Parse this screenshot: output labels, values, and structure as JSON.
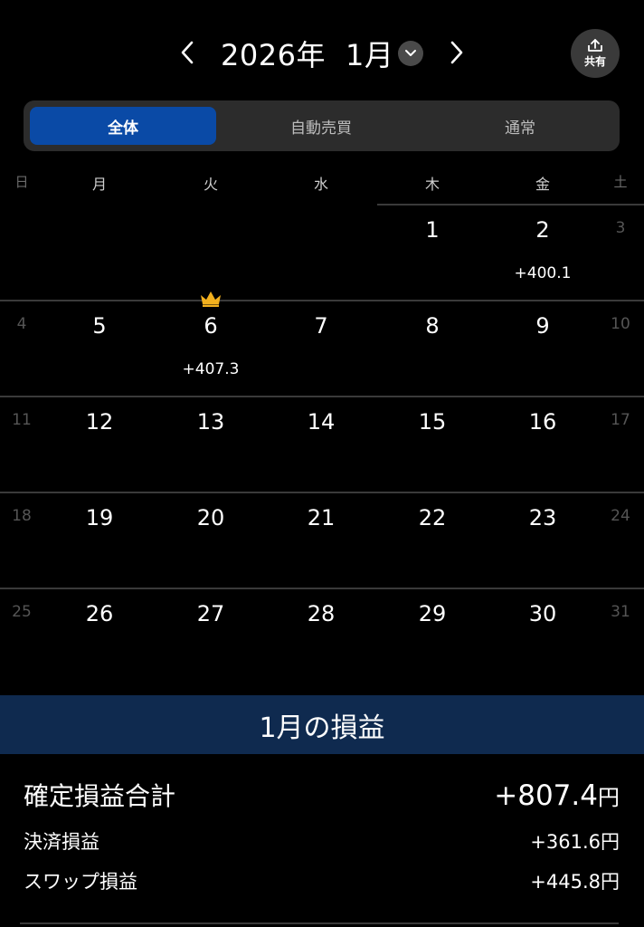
{
  "header": {
    "year_label": "2026年",
    "month_label": "1月",
    "share_label": "共有"
  },
  "segments": [
    "全体",
    "自動売買",
    "通常"
  ],
  "weekdays": [
    "日",
    "月",
    "火",
    "水",
    "木",
    "金",
    "土"
  ],
  "calendar": {
    "rows": [
      [
        "",
        "",
        "",
        "",
        "1",
        "2",
        "3"
      ],
      [
        "4",
        "5",
        "6",
        "7",
        "8",
        "9",
        "10"
      ],
      [
        "11",
        "12",
        "13",
        "14",
        "15",
        "16",
        "17"
      ],
      [
        "18",
        "19",
        "20",
        "21",
        "22",
        "23",
        "24"
      ],
      [
        "25",
        "26",
        "27",
        "28",
        "29",
        "30",
        "31"
      ]
    ],
    "pnl": {
      "jan2": "+400.1",
      "jan6": "+407.3"
    }
  },
  "summary": {
    "title": "1月の損益",
    "total_label": "確定損益合計",
    "total_value": "+807.4",
    "total_unit": "円",
    "settlement_label": "決済損益",
    "settlement_value": "+361.6円",
    "swap_label": "スワップ損益",
    "swap_value": "+445.8円"
  },
  "colors": {
    "active_segment": "#0a4aa6",
    "summary_bar": "#0f2a4f",
    "crown": "#f2b01e"
  }
}
